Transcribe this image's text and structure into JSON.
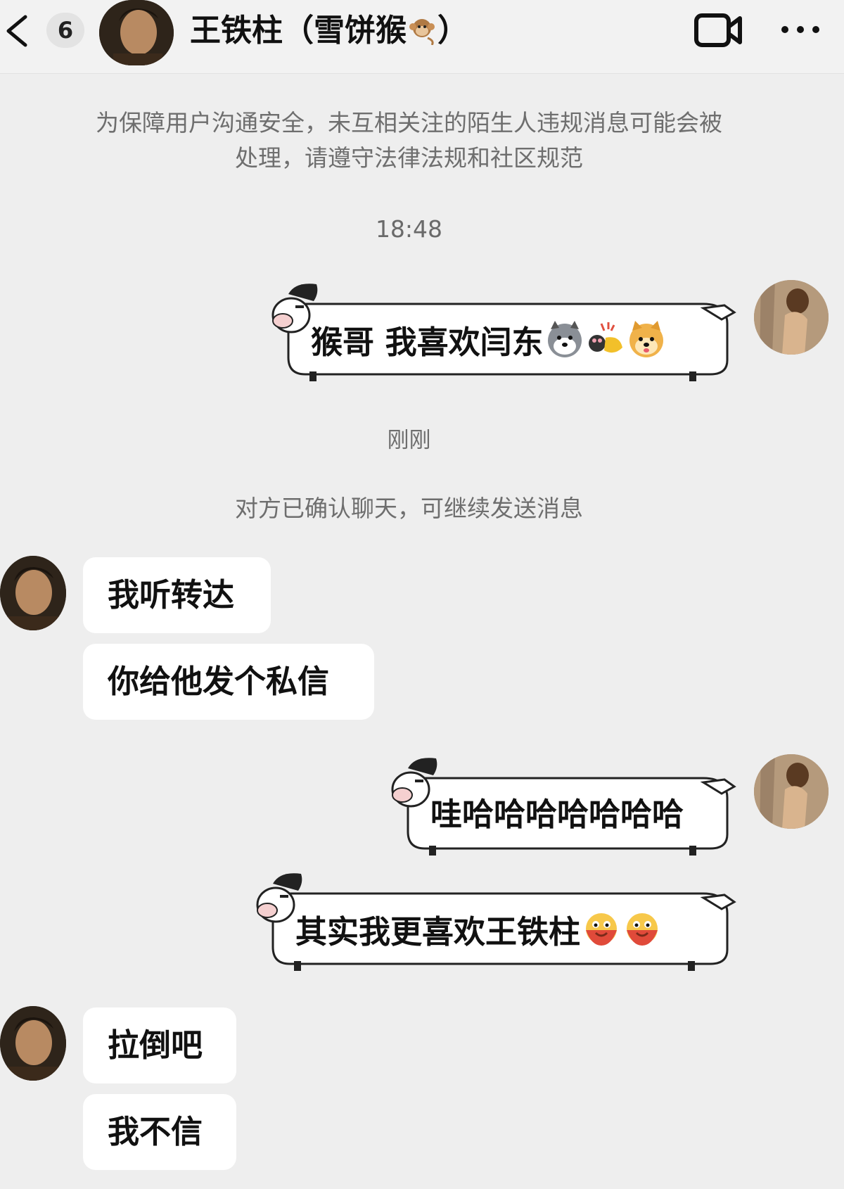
{
  "header": {
    "back_label": "返回",
    "unread_count": "6",
    "contact_name": "王铁柱（雪饼猴",
    "contact_name_close": "）",
    "name_emoji": "monkey-icon",
    "video_icon": "video-call-icon",
    "more_icon": "more-icon"
  },
  "system": {
    "notice_line1": "为保障用户沟通安全，未互相关注的陌生人违规消息可能会被",
    "notice_line2": "处理，请遵守法律法规和社区规范",
    "time1": "18:48",
    "time2": "刚刚",
    "confirm": "对方已确认聊天，可继续发送消息"
  },
  "messages": {
    "m1": "猴哥  我喜欢闫东",
    "m2": "我听转达",
    "m3": "你给他发个私信",
    "m4": "哇哈哈哈哈哈哈哈",
    "m5": "其实我更喜欢王铁柱",
    "m6": "拉倒吧",
    "m7": "我不信"
  },
  "colors": {
    "background": "#eeeeee",
    "bubble_received": "#ffffff",
    "system_text": "#6e6e6e"
  }
}
